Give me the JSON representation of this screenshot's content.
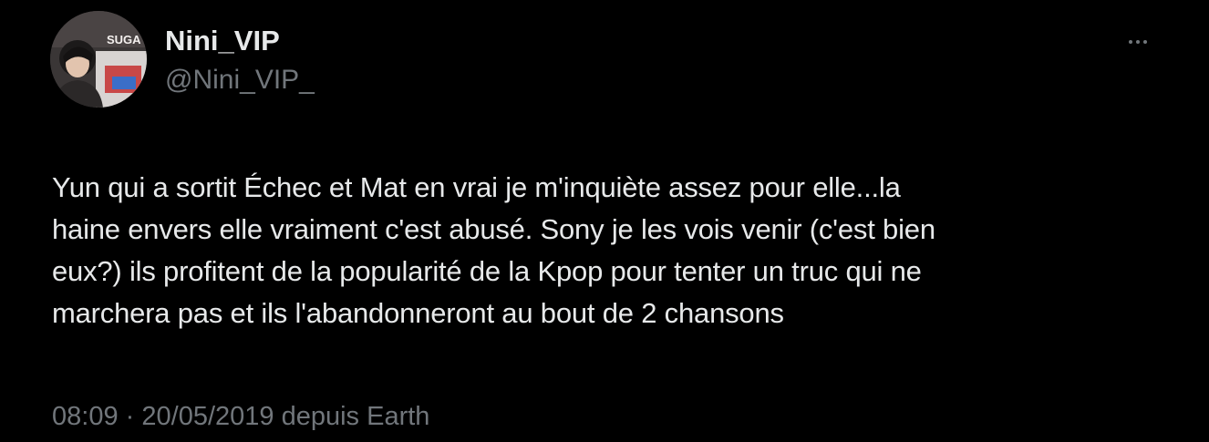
{
  "user": {
    "display_name": "Nini_VIP",
    "handle": "@Nini_VIP_",
    "avatar_text": "SUGA"
  },
  "actions": {
    "more_icon": "more-horizontal-icon"
  },
  "tweet": {
    "lines": [
      "Yun qui a sortit Échec et Mat en vrai je m'inquiète assez pour elle...la",
      "haine envers elle vraiment c'est abusé. Sony je les vois venir (c'est bien",
      "eux?) ils profitent de la popularité de la Kpop pour tenter un truc qui ne",
      "marchera pas et ils l'abandonneront au bout de 2 chansons"
    ]
  },
  "meta": {
    "time": "08:09",
    "separator": "·",
    "date": "20/05/2019",
    "source": "depuis Earth"
  },
  "colors": {
    "background": "#000000",
    "text_primary": "#e7e9ea",
    "text_secondary": "#71767b"
  }
}
